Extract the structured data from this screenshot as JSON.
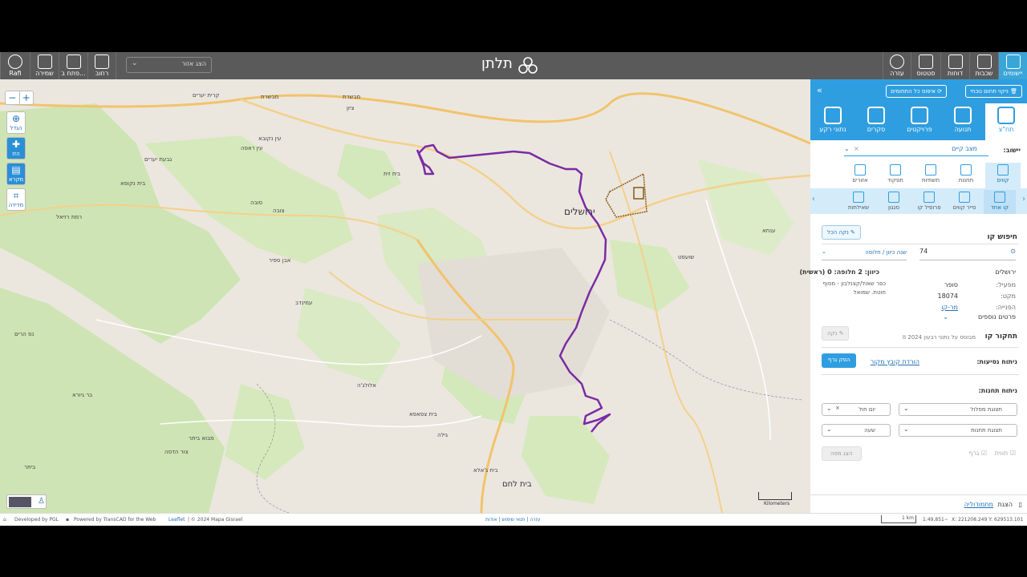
{
  "topbar": {
    "app_title": "תלתן",
    "user_label": "Rafi",
    "left_buttons": [
      "שמירה",
      "פתח ב...",
      "רחוב"
    ],
    "right_buttons": [
      "עזרה",
      "סטטוס",
      "דוחות",
      "שכבות",
      "יישומים"
    ],
    "region_select": "הצג אזור"
  },
  "map": {
    "city_label": "ירושלים",
    "bethlehem_label": "בית לחם",
    "labels": [
      "מבשרת",
      "ציון",
      "קרית יערים",
      "מבשרת",
      "עין ראפה",
      "גבעת יערים",
      "עין נקובא",
      "בית זית",
      "בית נקופא",
      "רמת רזיאל",
      "סובה",
      "צובה",
      "אבן ספיר",
      "עמינדב",
      "בר גיורא",
      "נס הרים",
      "מבוא ביתר",
      "צור הדסה",
      "ביתר",
      "גילה",
      "בית צפאפא",
      "בית ג'אלא",
      "אלולג'ה",
      "שועפט",
      "ענתא"
    ],
    "tools": [
      {
        "glyph": "⊕",
        "label": "הגדל"
      },
      {
        "glyph": "✚",
        "label": "הזז"
      },
      {
        "glyph": "▤",
        "label": "מקרא"
      },
      {
        "glyph": "⌗",
        "label": "מדידה"
      }
    ],
    "zoom_in": "+",
    "zoom_out": "−",
    "scale_label": "Kilometers"
  },
  "footer": {
    "developed": "Developed by PGL",
    "powered": "Powered by TransCAD for the Web",
    "leaflet": "Leaflet",
    "copyright": "| © 2024 Mapa Gisrael",
    "links": "עזרה | תנאי שימוש | אודות",
    "scale": "1 km",
    "ratio": "1:49,851~",
    "coords": "X: 221208.249 Y: 629513.101"
  },
  "panel": {
    "clear_area_btn": "ניקוי תחום נוכחי",
    "reset_btn": "איפוס כל התחומים",
    "categories": [
      "תח\"צ",
      "תנועה",
      "פרויקטים",
      "סקרים",
      "נתוני רקע"
    ],
    "settlement_label": "יישוב:",
    "settlement_value": "מצב קיים",
    "subtabs_row1": [
      "קווים",
      "תחנות",
      "תשתיות",
      "תפקוד",
      "אזורים"
    ],
    "subtabs_row2": [
      "קו אחד",
      "סייר קווים",
      "פרופיל קו",
      "סנגון",
      "שאילתות"
    ],
    "search_title": "חיפוש קו",
    "clear_all": "נקה הכל",
    "line_number": "74",
    "direction_select": "שנה כיוון / חלופה",
    "city": "ירושלים",
    "direction_info": "כיוון: 2 חלופה: 0 (ראשית)",
    "route_desc": "כפר שאול/קצנלבון - מסוף חוטת. שמואל",
    "operator_label": "מפעיל:",
    "operator_value": "סופר",
    "makat_label": "מקט:",
    "makat_value": "18074",
    "sign_label": "הפנייה:",
    "sign_value": "מר-קו",
    "more_details": "פרטים נוספים",
    "study_title": "תחקור קו",
    "study_note": "מבוסס על נתוני רבעון II 2024",
    "clear_btn": "נקה",
    "ridership_label": "ניתוח נסיעות:",
    "download_link": "הורדת קובץ מקור",
    "graph_btn": "הפק גרף",
    "stations_label": "ניתוח תחנות:",
    "route_view": "תצוגת מסלול",
    "day_type": "יום חול",
    "stops_view": "תצוגת תחנות",
    "hour": "שעה",
    "show_map_btn": "הצג מפה",
    "check_label1": "תווית",
    "check_label2": "גרף",
    "bottom_show": "הצגת",
    "bottom_link": "מתמודוליה"
  }
}
